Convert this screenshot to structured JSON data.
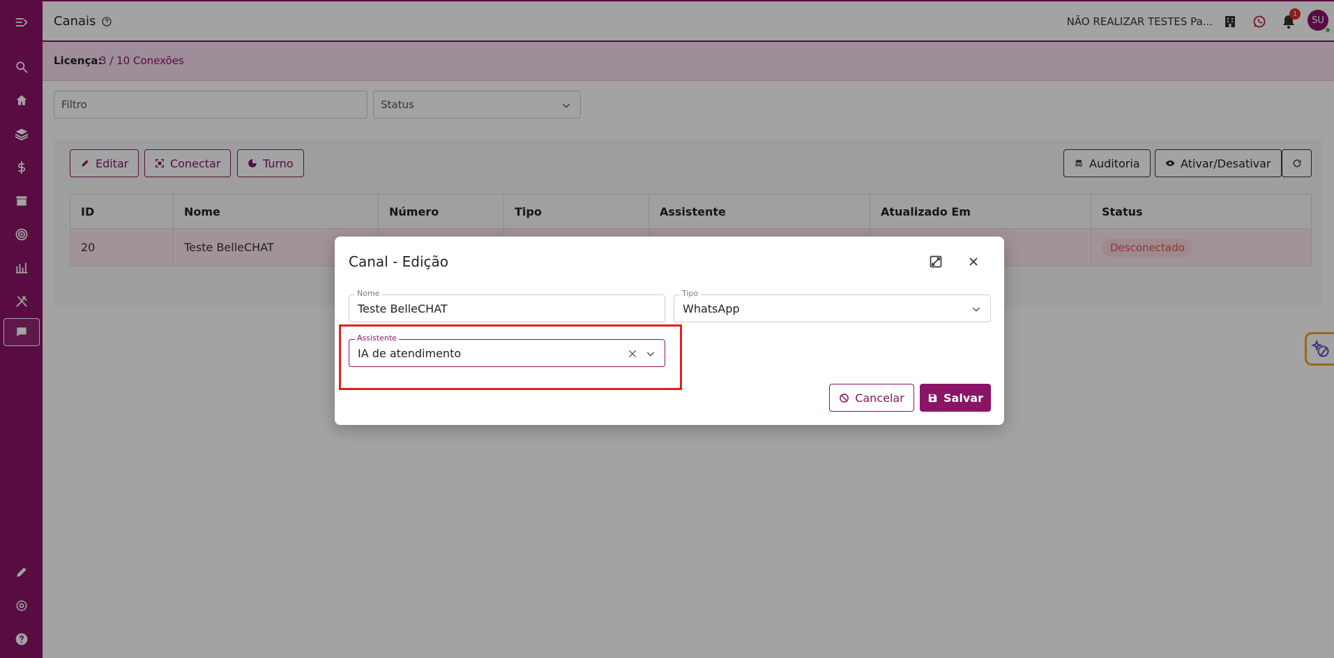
{
  "header": {
    "title": "Canais",
    "org_name": "NÃO REALIZAR TESTES Pa...",
    "notification_count": "1",
    "avatar_initials": "SU"
  },
  "license": {
    "label": "Licença:",
    "value": "3 / 10 Conexões"
  },
  "filters": {
    "filter_placeholder": "Filtro",
    "status_placeholder": "Status"
  },
  "toolbar": {
    "edit_label": "Editar",
    "connect_label": "Conectar",
    "shift_label": "Turno",
    "audit_label": "Auditoria",
    "toggle_label": "Ativar/Desativar"
  },
  "table": {
    "columns": [
      "ID",
      "Nome",
      "Número",
      "Tipo",
      "Assistente",
      "Atualizado Em",
      "Status"
    ],
    "rows": [
      {
        "id": "20",
        "name": "Teste BelleCHAT",
        "number": "",
        "type": "",
        "assistant": "",
        "updated": "",
        "status": "Desconectado"
      }
    ]
  },
  "modal": {
    "title": "Canal - Edição",
    "name_label": "Nome",
    "name_value": "Teste BelleCHAT",
    "type_label": "Tipo",
    "type_value": "WhatsApp",
    "assistant_label": "Assistente",
    "assistant_value": "IA de atendimento",
    "cancel_label": "Cancelar",
    "save_label": "Salvar"
  },
  "colors": {
    "brand": "#8a1466",
    "highlight": "#e41e1e",
    "status_disconnected": "#d9534f"
  }
}
